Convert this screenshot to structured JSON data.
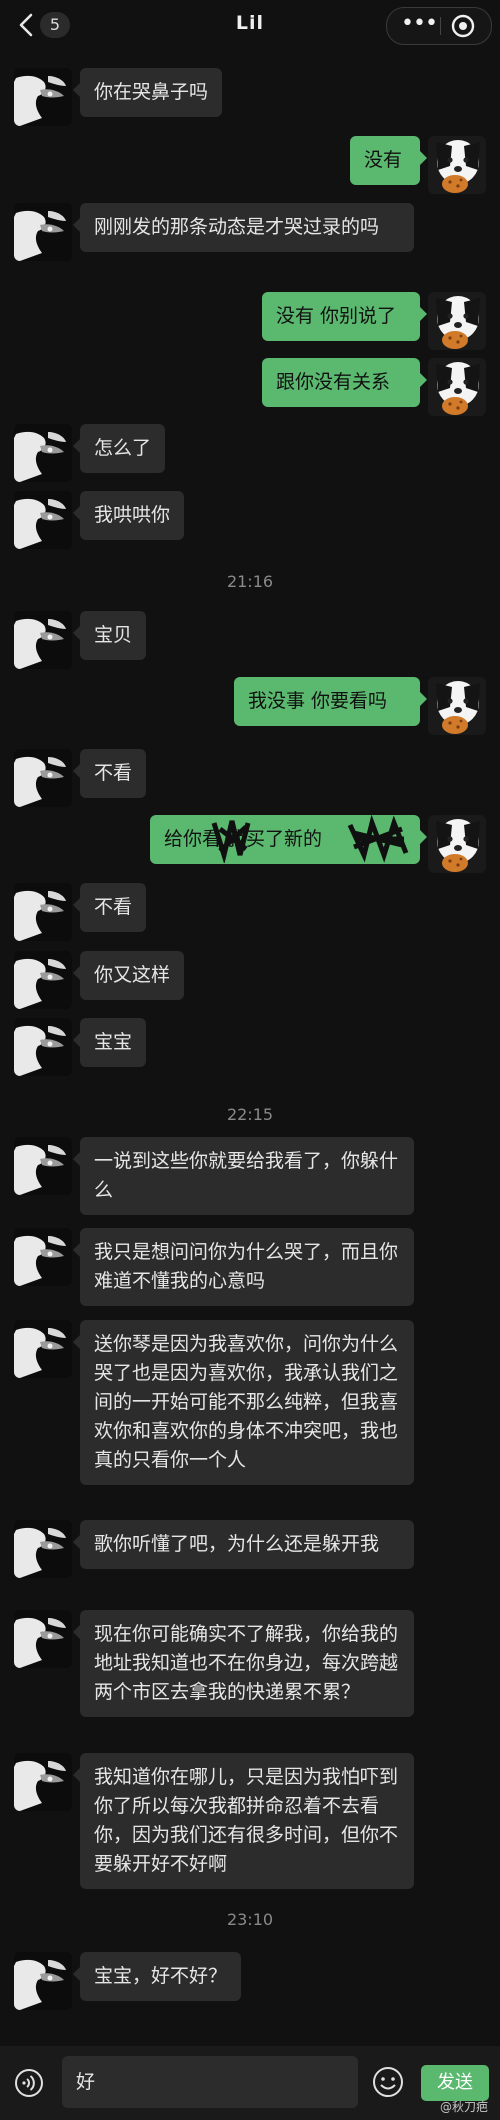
{
  "header": {
    "back_count": "5",
    "title": "Lil",
    "more_icon": "more-dots-icon",
    "target_icon": "mini-program-close-icon"
  },
  "messages": [
    {
      "from": "her",
      "text": "你在哭鼻子吗"
    },
    {
      "from": "me",
      "text": "没有"
    },
    {
      "from": "her",
      "text": "刚刚发的那条动态是才哭过录的吗"
    },
    {
      "from": "me",
      "text": "没有 你别说了"
    },
    {
      "from": "me",
      "text": "跟你没有关系"
    },
    {
      "from": "her",
      "text": "怎么了"
    },
    {
      "from": "her",
      "text": "我哄哄你"
    },
    {
      "type": "time",
      "text": "21:16"
    },
    {
      "from": "her",
      "text": "宝贝"
    },
    {
      "from": "me",
      "text": "我没事 你要看吗"
    },
    {
      "from": "her",
      "text": "不看"
    },
    {
      "from": "me",
      "text": "给你看 我买了新的",
      "censored": true
    },
    {
      "from": "her",
      "text": "不看"
    },
    {
      "from": "her",
      "text": "你又这样"
    },
    {
      "from": "her",
      "text": "宝宝"
    },
    {
      "type": "time",
      "text": "22:15"
    },
    {
      "from": "her",
      "text": "一说到这些你就要给我看了，你躲什么"
    },
    {
      "from": "her",
      "text": "我只是想问问你为什么哭了，而且你难道不懂我的心意吗"
    },
    {
      "from": "her",
      "text": "送你琴是因为我喜欢你，问你为什么哭了也是因为喜欢你，我承认我们之间的一开始可能不那么纯粹，但我喜欢你和喜欢你的身体不冲突吧，我也真的只看你一个人"
    },
    {
      "from": "her",
      "text": "歌你听懂了吧，为什么还是躲开我"
    },
    {
      "from": "her",
      "text": "现在你可能确实不了解我，你给我的地址我知道也不在你身边，每次跨越两个市区去拿我的快递累不累？"
    },
    {
      "from": "her",
      "text": "我知道你在哪儿，只是因为我怕吓到你了所以每次我都拼命忍着不去看你，因为我们还有很多时间，但你不要躲开好不好啊"
    },
    {
      "type": "time",
      "text": "23:10"
    },
    {
      "from": "her",
      "text": "宝宝，好不好？"
    }
  ],
  "input": {
    "text": "好",
    "send_label": "发送",
    "voice_icon": "voice-icon",
    "emoji_icon": "emoji-icon"
  },
  "watermark": "@秋刀疤",
  "colors": {
    "background": "#111111",
    "incoming_bubble": "#2c2c2c",
    "outgoing_bubble": "#5ab96f",
    "timestamp": "#8a8a8a"
  }
}
